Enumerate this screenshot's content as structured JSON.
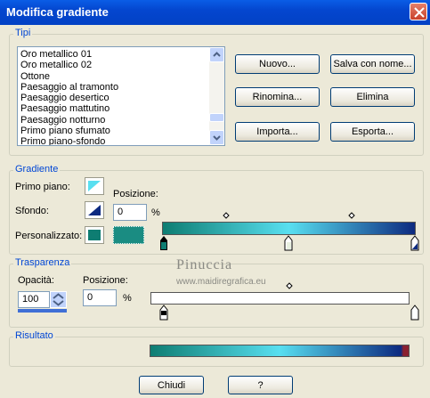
{
  "window": {
    "title": "Modifica gradiente",
    "close_icon": "close-icon"
  },
  "tipi": {
    "label": "Tipi",
    "items": [
      "Oro metallico 01",
      "Oro metallico 02",
      "Ottone",
      "Paesaggio al tramonto",
      "Paesaggio desertico",
      "Paesaggio mattutino",
      "Paesaggio notturno",
      "Primo piano sfumato",
      "Primo piano-sfondo"
    ],
    "buttons": {
      "nuovo": "Nuovo...",
      "salva": "Salva con nome...",
      "rinomina": "Rinomina...",
      "elimina": "Elimina",
      "importa": "Importa...",
      "esporta": "Esporta..."
    }
  },
  "gradiente": {
    "label": "Gradiente",
    "primo_piano": "Primo piano:",
    "sfondo": "Sfondo:",
    "personalizzato": "Personalizzato:",
    "posizione_label": "Posizione:",
    "posizione_value": "0",
    "percent": "%",
    "colors": {
      "start": "#0e7d72",
      "mid": "#58dff0",
      "end": "#0d2a80"
    }
  },
  "trasparenza": {
    "label": "Trasparenza",
    "opacita_label": "Opacità:",
    "opacita_value": "100",
    "posizione_label": "Posizione:",
    "posizione_value": "0",
    "percent": "%"
  },
  "watermark": {
    "line1": "Pinuccia",
    "line2": "www.maidiregrafica.eu"
  },
  "risultato": {
    "label": "Risultato"
  },
  "footer": {
    "chiudi": "Chiudi",
    "help": "?"
  }
}
